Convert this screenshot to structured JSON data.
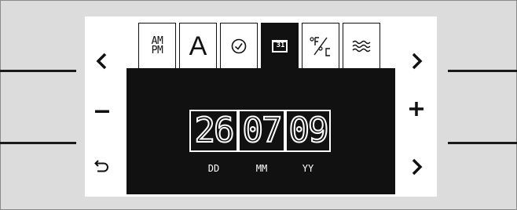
{
  "tabs": [
    {
      "id": "ampm",
      "label_line1": "AM",
      "label_line2": "PM",
      "icon": "am-pm-icon"
    },
    {
      "id": "font",
      "label": "A",
      "icon": "letter-a-icon"
    },
    {
      "id": "clock",
      "icon": "clock-icon"
    },
    {
      "id": "calendar",
      "label": "31",
      "icon": "calendar-icon",
      "active": true
    },
    {
      "id": "units",
      "icon": "fahrenheit-celsius-icon"
    },
    {
      "id": "heat",
      "icon": "heat-waves-icon"
    }
  ],
  "controls": {
    "prev": "chevron-left-icon",
    "next": "chevron-right-icon",
    "minus": "minus-icon",
    "plus": "plus-icon",
    "back": "back-arrow-icon",
    "confirm": "chevron-right-icon"
  },
  "date": {
    "day": "26",
    "month": "07",
    "year": "09",
    "day_label": "DD",
    "month_label": "MM",
    "year_label": "YY",
    "selected_field": "day"
  },
  "colors": {
    "background": "#dcdcdc",
    "panel": "#ffffff",
    "screen": "#111111",
    "foreground": "#111111",
    "display_text": "#ffffff"
  }
}
